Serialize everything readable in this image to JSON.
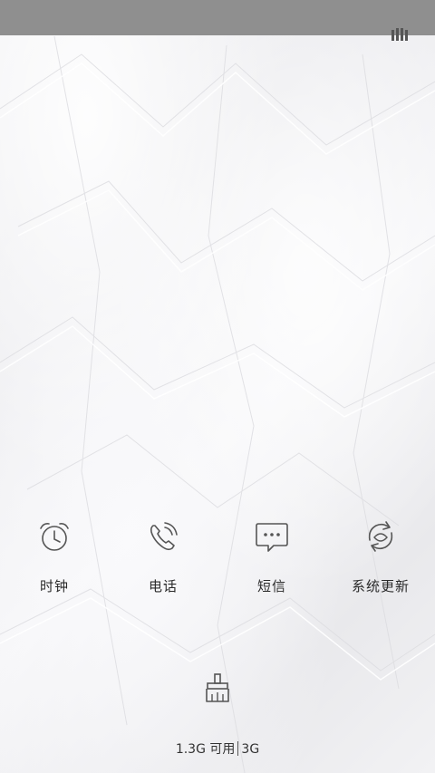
{
  "status_bar": {
    "icon": "signal-bars-icon"
  },
  "apps": [
    {
      "label": "时钟",
      "icon": "alarm-clock-icon"
    },
    {
      "label": "电话",
      "icon": "phone-icon"
    },
    {
      "label": "短信",
      "icon": "message-icon"
    },
    {
      "label": "系统更新",
      "icon": "sync-icon"
    }
  ],
  "cleaner": {
    "icon": "broom-icon"
  },
  "memory": {
    "available": "1.3G 可用",
    "total": "3G"
  },
  "colors": {
    "status_bar": "#8f8f8f",
    "icon_stroke": "#555555",
    "label": "#2a2a2a"
  }
}
